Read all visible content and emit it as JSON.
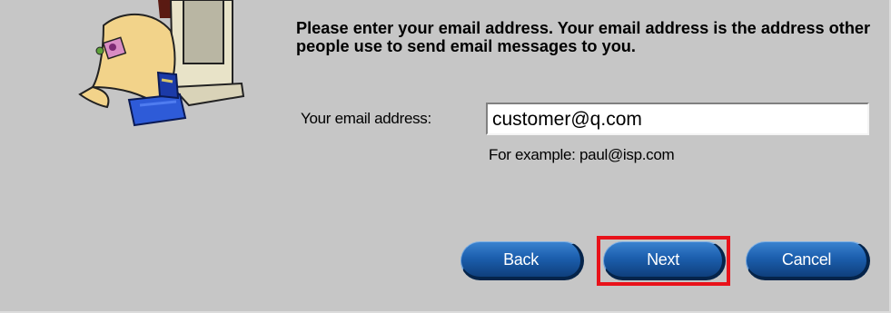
{
  "wizard": {
    "intro_text": "Please enter your email address. Your email address is the address other people use to send email messages to you.",
    "email_label": "Your email address:",
    "email_value": "customer@q.com",
    "example_text": "For example: paul@isp.com"
  },
  "buttons": {
    "back": "Back",
    "next": "Next",
    "cancel": "Cancel"
  },
  "highlight": {
    "target": "next-button",
    "color": "#e8121a"
  },
  "colors": {
    "background": "#c6c6c6",
    "button": "#1c5fae"
  },
  "icons": {
    "illustration": "computer-with-mail-envelope-illustration"
  }
}
